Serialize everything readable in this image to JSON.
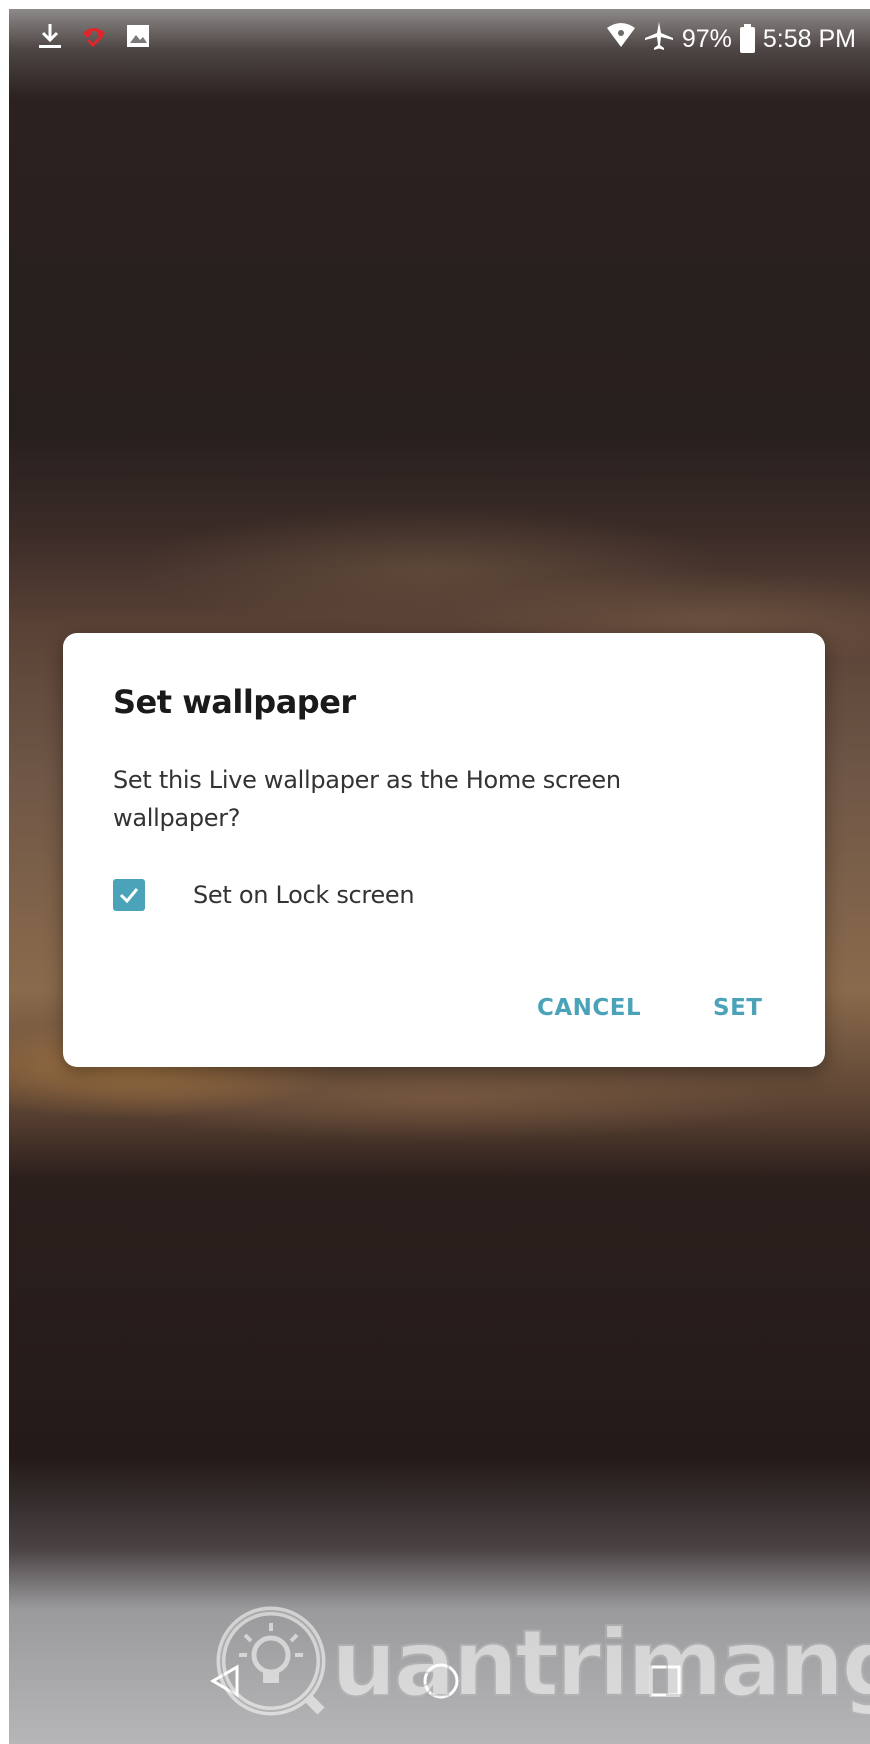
{
  "status_bar": {
    "icons_left": [
      "download-icon",
      "missed-call-icon",
      "image-icon"
    ],
    "icons_right": [
      "wifi-icon",
      "airplane-mode-icon"
    ],
    "battery": "97%",
    "time": "5:58 PM"
  },
  "dialog": {
    "title": "Set wallpaper",
    "message": "Set this Live wallpaper as the Home screen wallpaper?",
    "checkbox": {
      "label": "Set on Lock screen",
      "checked": true
    },
    "buttons": {
      "cancel": "CANCEL",
      "set": "SET"
    }
  },
  "nav_bar": {
    "buttons": [
      "back-icon",
      "home-icon",
      "recents-icon"
    ]
  },
  "watermark": {
    "text": "uantrimang"
  },
  "colors": {
    "accent": "#4aa3b8",
    "dialog_bg": "#ffffff",
    "title_text": "#1a1a1a",
    "body_text": "#333333"
  }
}
